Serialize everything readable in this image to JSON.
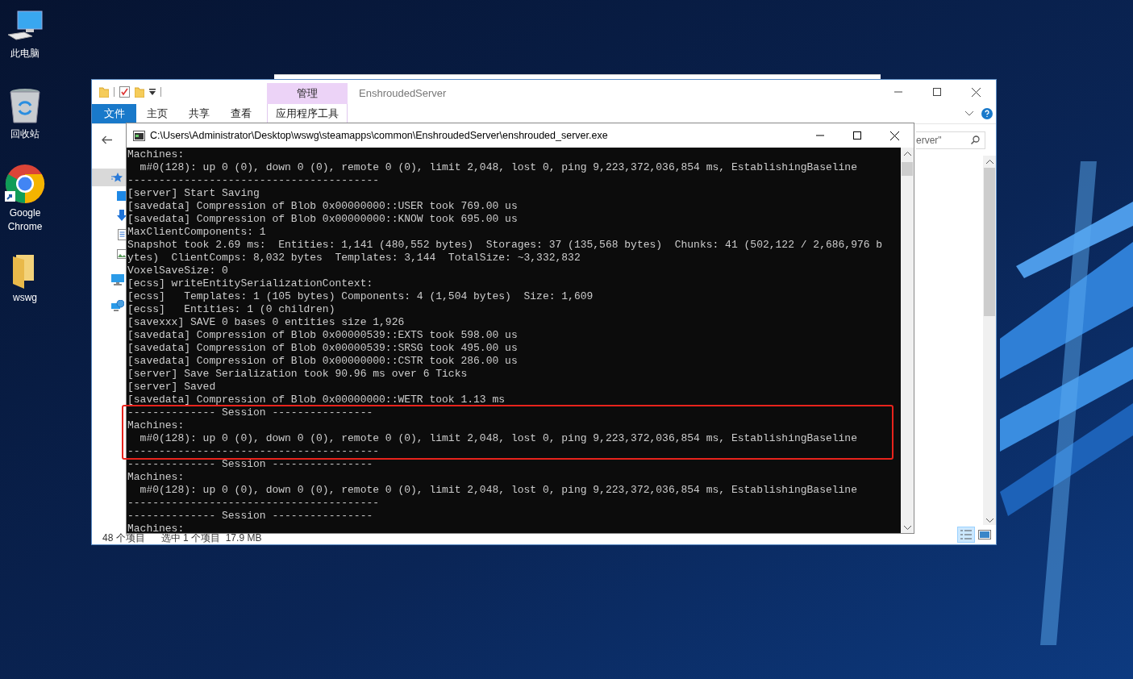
{
  "desktop_icons": [
    {
      "label": "此电脑",
      "kind": "computer"
    },
    {
      "label": "回收站",
      "kind": "recycle"
    },
    {
      "label": "Google Chrome",
      "kind": "chrome"
    },
    {
      "label": "wswg",
      "kind": "folder"
    }
  ],
  "explorer": {
    "title": "EnshroudedServer",
    "context_tab": "管理",
    "tabs": [
      {
        "label": "文件",
        "kind": "file"
      },
      {
        "label": "主页",
        "kind": "tab"
      },
      {
        "label": "共享",
        "kind": "tab"
      },
      {
        "label": "查看",
        "kind": "tab"
      },
      {
        "label": "应用程序工具",
        "kind": "context"
      }
    ],
    "search_value": "erver\"",
    "status": {
      "count": "48 个项目",
      "selection": "选中 1 个项目  17.9 MB"
    }
  },
  "console": {
    "title": "C:\\Users\\Administrator\\Desktop\\wswg\\steamapps\\common\\EnshroudedServer\\enshrouded_server.exe",
    "lines": [
      {
        "text": "Machines:",
        "highlighted": false
      },
      {
        "text": "  m#0(128): up 0 (0), down 0 (0), remote 0 (0), limit 2,048, lost 0, ping 9,223,372,036,854 ms, EstablishingBaseline",
        "highlighted": false
      },
      {
        "text": "----------------------------------------",
        "highlighted": false
      },
      {
        "text": "[server] Start Saving",
        "highlighted": false
      },
      {
        "text": "[savedata] Compression of Blob 0x00000000::USER took 769.00 us",
        "highlighted": false
      },
      {
        "text": "[savedata] Compression of Blob 0x00000000::KNOW took 695.00 us",
        "highlighted": false
      },
      {
        "text": "MaxClientComponents: 1",
        "highlighted": false
      },
      {
        "text": "Snapshot took 2.69 ms:  Entities: 1,141 (480,552 bytes)  Storages: 37 (135,568 bytes)  Chunks: 41 (502,122 / 2,686,976 b",
        "highlighted": false
      },
      {
        "text": "ytes)  ClientComps: 8,032 bytes  Templates: 3,144  TotalSize: ~3,332,832",
        "highlighted": false
      },
      {
        "text": "VoxelSaveSize: 0",
        "highlighted": false
      },
      {
        "text": "[ecss] writeEntitySerializationContext:",
        "highlighted": false
      },
      {
        "text": "[ecss]   Templates: 1 (105 bytes) Components: 4 (1,504 bytes)  Size: 1,609",
        "highlighted": false
      },
      {
        "text": "[ecss]   Entities: 1 (0 children)",
        "highlighted": false
      },
      {
        "text": "[savexxx] SAVE 0 bases 0 entities size 1,926",
        "highlighted": false
      },
      {
        "text": "[savedata] Compression of Blob 0x00000539::EXTS took 598.00 us",
        "highlighted": false
      },
      {
        "text": "[savedata] Compression of Blob 0x00000539::SRSG took 495.00 us",
        "highlighted": false
      },
      {
        "text": "[savedata] Compression of Blob 0x00000000::CSTR took 286.00 us",
        "highlighted": false
      },
      {
        "text": "[server] Save Serialization took 90.96 ms over 6 Ticks",
        "highlighted": false
      },
      {
        "text": "[server] Saved",
        "highlighted": false
      },
      {
        "text": "[savedata] Compression of Blob 0x00000000::WETR took 1.13 ms",
        "highlighted": false
      },
      {
        "text": "-------------- Session ----------------",
        "highlighted": true
      },
      {
        "text": "Machines:",
        "highlighted": true
      },
      {
        "text": "  m#0(128): up 0 (0), down 0 (0), remote 0 (0), limit 2,048, lost 0, ping 9,223,372,036,854 ms, EstablishingBaseline",
        "highlighted": true
      },
      {
        "text": "----------------------------------------",
        "highlighted": true
      },
      {
        "text": "-------------- Session ----------------",
        "highlighted": false
      },
      {
        "text": "Machines:",
        "highlighted": false
      },
      {
        "text": "  m#0(128): up 0 (0), down 0 (0), remote 0 (0), limit 2,048, lost 0, ping 9,223,372,036,854 ms, EstablishingBaseline",
        "highlighted": false
      },
      {
        "text": "----------------------------------------",
        "highlighted": false
      },
      {
        "text": "-------------- Session ----------------",
        "highlighted": false
      },
      {
        "text": "Machines:",
        "highlighted": false
      }
    ]
  }
}
